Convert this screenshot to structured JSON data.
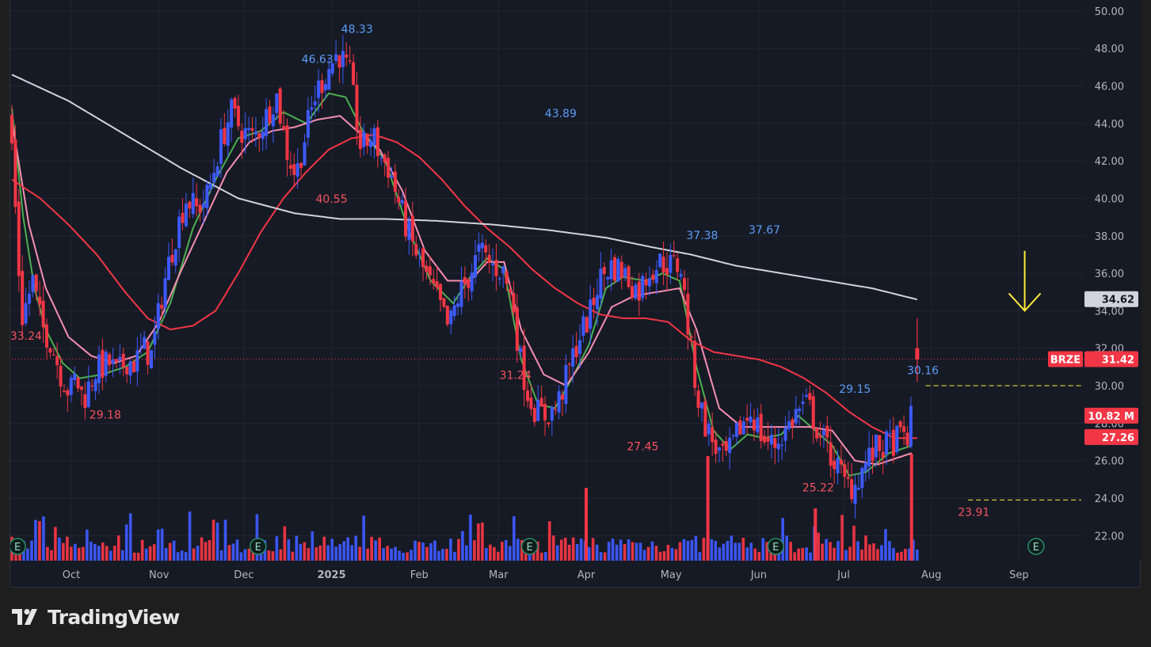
{
  "brand": {
    "name": "TradingView",
    "logo_icon": "tradingview-logo-icon"
  },
  "theme": {
    "background": "#161a25",
    "up_color": "#3d5afe",
    "down_color": "#f23645",
    "ma_fast_color": "#4caf50",
    "ma_mid_color": "#f48fb1",
    "ma_slow_color": "#f23645",
    "ma_long_color": "#d1d4dc",
    "arrow_color": "#ffeb3b",
    "label_high_color": "#5b9cf6",
    "label_low_color": "#f7525f"
  },
  "chart_data": {
    "type": "candlestick",
    "symbol": "BRZE",
    "y_axis": {
      "min": 21,
      "max": 50.5,
      "ticks": [
        "22.00",
        "24.00",
        "26.00",
        "28.00",
        "30.00",
        "32.00",
        "34.00",
        "36.00",
        "38.00",
        "40.00",
        "42.00",
        "44.00",
        "46.00",
        "48.00",
        "50.00"
      ]
    },
    "x_axis": {
      "labels": [
        {
          "text": "Oct",
          "day": 21
        },
        {
          "text": "Nov",
          "day": 52
        },
        {
          "text": "Dec",
          "day": 82
        },
        {
          "text": "2025",
          "day": 113,
          "bold": true
        },
        {
          "text": "Feb",
          "day": 144
        },
        {
          "text": "Mar",
          "day": 172
        },
        {
          "text": "Apr",
          "day": 203
        },
        {
          "text": "May",
          "day": 233
        },
        {
          "text": "Jun",
          "day": 264
        },
        {
          "text": "Jul",
          "day": 294
        },
        {
          "text": "Aug",
          "day": 325
        },
        {
          "text": "Sep",
          "day": 356
        }
      ]
    },
    "price_path": [
      [
        0,
        44.5
      ],
      [
        4,
        33.5
      ],
      [
        8,
        35.6
      ],
      [
        11,
        33.2
      ],
      [
        14,
        32.5
      ],
      [
        18,
        30.6
      ],
      [
        21,
        29.6
      ],
      [
        23,
        30.4
      ],
      [
        26,
        29.3
      ],
      [
        30,
        30.8
      ],
      [
        35,
        31.2
      ],
      [
        38,
        30.6
      ],
      [
        41,
        31.4
      ],
      [
        44,
        31.2
      ],
      [
        47,
        32.0
      ],
      [
        50,
        31.6
      ],
      [
        54,
        35.2
      ],
      [
        58,
        37.8
      ],
      [
        62,
        40.0
      ],
      [
        66,
        39.4
      ],
      [
        70,
        40.2
      ],
      [
        74,
        42.8
      ],
      [
        78,
        44.6
      ],
      [
        82,
        43.6
      ],
      [
        86,
        43.2
      ],
      [
        90,
        44.2
      ],
      [
        94,
        45.6
      ],
      [
        98,
        42.4
      ],
      [
        101,
        41.2
      ],
      [
        104,
        43.2
      ],
      [
        108,
        45.6
      ],
      [
        112,
        46.8
      ],
      [
        116,
        47.8
      ],
      [
        120,
        46.6
      ],
      [
        124,
        42.6
      ],
      [
        128,
        43.4
      ],
      [
        131,
        42.2
      ],
      [
        134,
        41.6
      ],
      [
        138,
        39.4
      ],
      [
        142,
        37.6
      ],
      [
        146,
        36.2
      ],
      [
        149,
        35.2
      ],
      [
        152,
        34.2
      ],
      [
        155,
        33.0
      ],
      [
        158,
        34.6
      ],
      [
        162,
        35.8
      ],
      [
        166,
        37.2
      ],
      [
        170,
        36.4
      ],
      [
        174,
        36.2
      ],
      [
        178,
        34.2
      ],
      [
        180,
        31.6
      ],
      [
        183,
        29.6
      ],
      [
        186,
        28.6
      ],
      [
        189,
        28.4
      ],
      [
        193,
        28.8
      ],
      [
        197,
        30.6
      ],
      [
        201,
        32.6
      ],
      [
        205,
        33.8
      ],
      [
        208,
        35.6
      ],
      [
        212,
        36.4
      ],
      [
        216,
        36.2
      ],
      [
        219,
        35.6
      ],
      [
        222,
        35.0
      ],
      [
        226,
        36.2
      ],
      [
        230,
        36.6
      ],
      [
        234,
        36.4
      ],
      [
        237,
        36.4
      ],
      [
        240,
        32.6
      ],
      [
        243,
        29.4
      ],
      [
        246,
        27.8
      ],
      [
        249,
        26.8
      ],
      [
        252,
        26.0
      ],
      [
        255,
        26.6
      ],
      [
        258,
        27.8
      ],
      [
        262,
        28.6
      ],
      [
        266,
        27.2
      ],
      [
        270,
        26.8
      ],
      [
        274,
        27.6
      ],
      [
        278,
        28.6
      ],
      [
        282,
        29.0
      ],
      [
        286,
        27.4
      ],
      [
        289,
        26.6
      ],
      [
        292,
        25.8
      ],
      [
        295,
        24.8
      ],
      [
        298,
        24.6
      ],
      [
        302,
        25.8
      ],
      [
        306,
        26.6
      ],
      [
        310,
        26.8
      ],
      [
        314,
        27.2
      ],
      [
        318,
        27.4
      ],
      [
        320,
        31.6
      ]
    ],
    "candles_count": 260,
    "last_candle": {
      "open": 32.0,
      "high": 33.6,
      "low": 30.2,
      "close": 31.4
    },
    "moving_averages": [
      {
        "id": "ma_fast",
        "anchors": [
          [
            0,
            44.8
          ],
          [
            4,
            39.0
          ],
          [
            8,
            35.2
          ],
          [
            12,
            33.0
          ],
          [
            18,
            31.2
          ],
          [
            24,
            30.4
          ],
          [
            32,
            30.6
          ],
          [
            40,
            31.0
          ],
          [
            48,
            31.8
          ],
          [
            56,
            34.4
          ],
          [
            64,
            38.4
          ],
          [
            72,
            41.0
          ],
          [
            80,
            43.2
          ],
          [
            88,
            43.6
          ],
          [
            96,
            44.6
          ],
          [
            104,
            44.0
          ],
          [
            112,
            45.6
          ],
          [
            118,
            45.4
          ],
          [
            124,
            43.6
          ],
          [
            132,
            42.0
          ],
          [
            140,
            38.4
          ],
          [
            148,
            35.6
          ],
          [
            156,
            34.4
          ],
          [
            162,
            35.8
          ],
          [
            168,
            36.8
          ],
          [
            174,
            36.2
          ],
          [
            180,
            31.4
          ],
          [
            186,
            29.0
          ],
          [
            192,
            28.8
          ],
          [
            198,
            30.4
          ],
          [
            204,
            32.2
          ],
          [
            210,
            35.2
          ],
          [
            216,
            35.8
          ],
          [
            224,
            35.6
          ],
          [
            230,
            36.0
          ],
          [
            236,
            35.6
          ],
          [
            242,
            31.0
          ],
          [
            248,
            27.6
          ],
          [
            254,
            26.6
          ],
          [
            260,
            27.4
          ],
          [
            266,
            27.2
          ],
          [
            272,
            27.4
          ],
          [
            278,
            28.4
          ],
          [
            284,
            27.6
          ],
          [
            290,
            26.8
          ],
          [
            296,
            25.2
          ],
          [
            302,
            25.4
          ],
          [
            310,
            26.4
          ],
          [
            318,
            26.8
          ]
        ]
      },
      {
        "id": "ma_mid",
        "anchors": [
          [
            0,
            44.2
          ],
          [
            6,
            38.6
          ],
          [
            12,
            35.2
          ],
          [
            20,
            32.6
          ],
          [
            28,
            31.6
          ],
          [
            36,
            31.2
          ],
          [
            44,
            31.6
          ],
          [
            52,
            33.4
          ],
          [
            60,
            36.2
          ],
          [
            68,
            38.8
          ],
          [
            76,
            41.4
          ],
          [
            84,
            43.0
          ],
          [
            92,
            43.6
          ],
          [
            100,
            43.8
          ],
          [
            108,
            44.2
          ],
          [
            116,
            44.4
          ],
          [
            122,
            43.6
          ],
          [
            130,
            42.6
          ],
          [
            138,
            40.4
          ],
          [
            146,
            37.2
          ],
          [
            154,
            35.6
          ],
          [
            162,
            35.6
          ],
          [
            168,
            36.6
          ],
          [
            174,
            36.6
          ],
          [
            180,
            33.0
          ],
          [
            188,
            30.6
          ],
          [
            196,
            30.0
          ],
          [
            204,
            31.8
          ],
          [
            212,
            34.2
          ],
          [
            220,
            34.8
          ],
          [
            228,
            35.0
          ],
          [
            236,
            35.2
          ],
          [
            242,
            33.0
          ],
          [
            250,
            28.8
          ],
          [
            258,
            27.8
          ],
          [
            266,
            27.8
          ],
          [
            274,
            27.8
          ],
          [
            282,
            27.8
          ],
          [
            290,
            27.6
          ],
          [
            298,
            26.0
          ],
          [
            306,
            25.8
          ],
          [
            318,
            26.4
          ]
        ]
      },
      {
        "id": "ma_slow",
        "anchors": [
          [
            0,
            41.0
          ],
          [
            10,
            40.0
          ],
          [
            20,
            38.6
          ],
          [
            30,
            37.0
          ],
          [
            40,
            35.0
          ],
          [
            48,
            33.6
          ],
          [
            56,
            33.0
          ],
          [
            64,
            33.2
          ],
          [
            72,
            34.0
          ],
          [
            80,
            36.0
          ],
          [
            88,
            38.2
          ],
          [
            96,
            40.0
          ],
          [
            104,
            41.4
          ],
          [
            112,
            42.6
          ],
          [
            120,
            43.2
          ],
          [
            128,
            43.4
          ],
          [
            136,
            43.0
          ],
          [
            144,
            42.2
          ],
          [
            152,
            41.0
          ],
          [
            160,
            39.6
          ],
          [
            168,
            38.4
          ],
          [
            176,
            37.4
          ],
          [
            184,
            36.2
          ],
          [
            192,
            35.2
          ],
          [
            200,
            34.4
          ],
          [
            208,
            33.8
          ],
          [
            216,
            33.6
          ],
          [
            224,
            33.6
          ],
          [
            232,
            33.4
          ],
          [
            240,
            32.4
          ],
          [
            248,
            31.8
          ],
          [
            256,
            31.6
          ],
          [
            264,
            31.4
          ],
          [
            272,
            31.0
          ],
          [
            280,
            30.4
          ],
          [
            288,
            29.6
          ],
          [
            296,
            28.6
          ],
          [
            304,
            27.8
          ],
          [
            312,
            27.2
          ],
          [
            320,
            27.2
          ]
        ]
      },
      {
        "id": "ma_long",
        "anchors": [
          [
            0,
            46.6
          ],
          [
            20,
            45.2
          ],
          [
            40,
            43.4
          ],
          [
            60,
            41.6
          ],
          [
            80,
            40.0
          ],
          [
            100,
            39.2
          ],
          [
            116,
            38.9
          ],
          [
            132,
            38.9
          ],
          [
            150,
            38.8
          ],
          [
            170,
            38.6
          ],
          [
            190,
            38.3
          ],
          [
            210,
            37.9
          ],
          [
            226,
            37.4
          ],
          [
            240,
            37.0
          ],
          [
            256,
            36.4
          ],
          [
            272,
            36.0
          ],
          [
            288,
            35.6
          ],
          [
            304,
            35.2
          ],
          [
            320,
            34.6
          ]
        ]
      }
    ],
    "volume_bars": 230,
    "volume_spikes": [
      {
        "day": 203,
        "height": 92,
        "color": "down"
      },
      {
        "day": 246,
        "height": 132,
        "color": "down"
      },
      {
        "day": 284,
        "height": 66,
        "color": "down"
      },
      {
        "day": 318,
        "height": 135,
        "color": "down"
      }
    ],
    "earnings": [
      {
        "day": 2
      },
      {
        "day": 87
      },
      {
        "day": 183
      },
      {
        "day": 270
      },
      {
        "day": 362
      }
    ],
    "swing_labels": [
      {
        "text": "33.24",
        "day": 5,
        "price": 33.3,
        "kind": "low"
      },
      {
        "text": "29.18",
        "day": 33,
        "price": 29.1,
        "kind": "low"
      },
      {
        "text": "46.63",
        "day": 108,
        "price": 46.8,
        "kind": "high"
      },
      {
        "text": "48.33",
        "day": 122,
        "price": 48.4,
        "kind": "high"
      },
      {
        "text": "40.55",
        "day": 113,
        "price": 40.6,
        "kind": "low"
      },
      {
        "text": "43.89",
        "day": 194,
        "price": 43.9,
        "kind": "high"
      },
      {
        "text": "31.24",
        "day": 178,
        "price": 31.2,
        "kind": "low"
      },
      {
        "text": "27.45",
        "day": 223,
        "price": 27.4,
        "kind": "low"
      },
      {
        "text": "37.38",
        "day": 244,
        "price": 37.4,
        "kind": "high"
      },
      {
        "text": "37.67",
        "day": 266,
        "price": 37.7,
        "kind": "high"
      },
      {
        "text": "25.22",
        "day": 285,
        "price": 25.2,
        "kind": "low"
      },
      {
        "text": "29.15",
        "day": 298,
        "price": 29.2,
        "kind": "high"
      },
      {
        "text": "30.16",
        "day": 322,
        "price": 30.2,
        "kind": "high"
      },
      {
        "text": "23.91",
        "day": 340,
        "price": 23.9,
        "kind": "low"
      }
    ],
    "horizontal_lines": [
      {
        "price": 30.0,
        "from_day": 323,
        "style": "dashed",
        "color": "#ffeb3b"
      },
      {
        "price": 23.9,
        "from_day": 338,
        "style": "dashed",
        "color": "#ffeb3b"
      },
      {
        "price": 31.42,
        "from_day": 0,
        "style": "dotted",
        "color": "#f23645"
      }
    ],
    "annotation_arrow": {
      "day": 358,
      "from_price": 37.2,
      "to_price": 34.0
    },
    "price_badges": [
      {
        "text": "34.62",
        "price": 34.62,
        "bg": "#d1d4dc",
        "fg": "#131722"
      },
      {
        "text": "31.42",
        "price": 31.42,
        "bg": "#f23645",
        "fg": "#ffffff",
        "prefix": "BRZE"
      },
      {
        "text": "10.82 M",
        "price": 28.4,
        "bg": "#f23645",
        "fg": "#ffffff"
      },
      {
        "text": "27.26",
        "price": 27.26,
        "bg": "#f23645",
        "fg": "#ffffff"
      }
    ]
  }
}
